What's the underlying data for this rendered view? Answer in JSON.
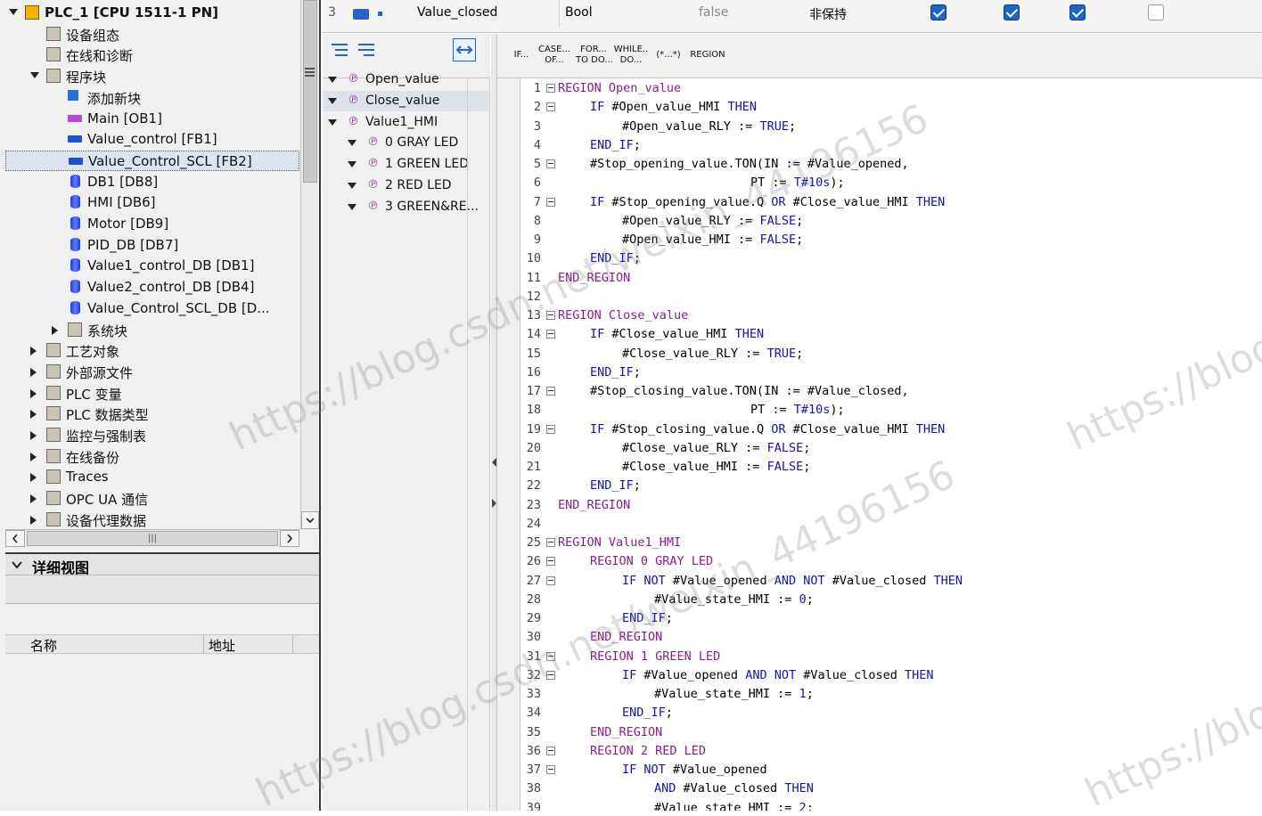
{
  "project_tree": {
    "items": [
      {
        "label": "PLC_1 [CPU 1511-1 PN]",
        "indent": 0,
        "toggle": "open",
        "icon": "plc-icon",
        "bold": true
      },
      {
        "label": "设备组态",
        "indent": 1,
        "toggle": "",
        "icon": "device-config-icon"
      },
      {
        "label": "在线和诊断",
        "indent": 1,
        "toggle": "",
        "icon": "online-diagnostics-icon"
      },
      {
        "label": "程序块",
        "indent": 1,
        "toggle": "open",
        "icon": "program-blocks-folder-icon"
      },
      {
        "label": "添加新块",
        "indent": 2,
        "toggle": "",
        "icon": "add-block-icon"
      },
      {
        "label": "Main [OB1]",
        "indent": 2,
        "toggle": "",
        "icon": "ob-block-icon"
      },
      {
        "label": "Value_control [FB1]",
        "indent": 2,
        "toggle": "",
        "icon": "fb-block-icon"
      },
      {
        "label": "Value_Control_SCL [FB2]",
        "indent": 2,
        "toggle": "",
        "icon": "fb-block-icon",
        "selected": true
      },
      {
        "label": "DB1 [DB8]",
        "indent": 2,
        "toggle": "",
        "icon": "db-block-icon"
      },
      {
        "label": "HMI [DB6]",
        "indent": 2,
        "toggle": "",
        "icon": "db-block-icon"
      },
      {
        "label": "Motor [DB9]",
        "indent": 2,
        "toggle": "",
        "icon": "db-block-icon"
      },
      {
        "label": "PID_DB [DB7]",
        "indent": 2,
        "toggle": "",
        "icon": "db-block-icon"
      },
      {
        "label": "Value1_control_DB [DB1]",
        "indent": 2,
        "toggle": "",
        "icon": "db-block-icon"
      },
      {
        "label": "Value2_control_DB [DB4]",
        "indent": 2,
        "toggle": "",
        "icon": "db-block-icon"
      },
      {
        "label": "Value_Control_SCL_DB [D...",
        "indent": 2,
        "toggle": "",
        "icon": "db-block-icon"
      },
      {
        "label": "系统块",
        "indent": 2,
        "toggle": "closed",
        "icon": "system-blocks-folder-icon"
      },
      {
        "label": "工艺对象",
        "indent": 1,
        "toggle": "closed",
        "icon": "technology-objects-icon"
      },
      {
        "label": "外部源文件",
        "indent": 1,
        "toggle": "closed",
        "icon": "external-sources-icon"
      },
      {
        "label": "PLC 变量",
        "indent": 1,
        "toggle": "closed",
        "icon": "plc-tags-icon"
      },
      {
        "label": "PLC 数据类型",
        "indent": 1,
        "toggle": "closed",
        "icon": "plc-datatypes-icon"
      },
      {
        "label": "监控与强制表",
        "indent": 1,
        "toggle": "closed",
        "icon": "watch-force-tables-icon"
      },
      {
        "label": "在线备份",
        "indent": 1,
        "toggle": "closed",
        "icon": "online-backups-icon"
      },
      {
        "label": "Traces",
        "indent": 1,
        "toggle": "closed",
        "icon": "traces-icon"
      },
      {
        "label": "OPC UA 通信",
        "indent": 1,
        "toggle": "closed",
        "icon": "opc-ua-icon"
      },
      {
        "label": "设备代理数据",
        "indent": 1,
        "toggle": "closed",
        "icon": "device-proxy-icon"
      }
    ]
  },
  "detail_view": {
    "title": "详细视图",
    "col_name": "名称",
    "col_address": "地址"
  },
  "interface_row": {
    "index": "3",
    "name": "Value_closed",
    "datatype": "Bool",
    "default": "false",
    "retain": "非保持",
    "checks": [
      true,
      true,
      true,
      false
    ]
  },
  "outline": {
    "items": [
      {
        "label": "Open_value",
        "indent": 0
      },
      {
        "label": "Close_value",
        "indent": 0,
        "selected": true
      },
      {
        "label": "Value1_HMI",
        "indent": 0
      },
      {
        "label": "0 GRAY LED",
        "indent": 1
      },
      {
        "label": "1 GREEN LED",
        "indent": 1
      },
      {
        "label": "2 RED LED",
        "indent": 1
      },
      {
        "label": "3 GREEN&RE...",
        "indent": 1
      }
    ]
  },
  "instructions": [
    {
      "label": "IF..."
    },
    {
      "label": "CASE...\nOF..."
    },
    {
      "label": "FOR...\nTO DO..."
    },
    {
      "label": "WHILE..\nDO..."
    },
    {
      "label": "(*...*)"
    },
    {
      "label": "REGION"
    }
  ],
  "code_lines": [
    {
      "n": "1",
      "fold": true,
      "indent": 0,
      "segs": [
        [
          "reg",
          "REGION Open_value"
        ]
      ]
    },
    {
      "n": "2",
      "fold": true,
      "indent": 1,
      "segs": [
        [
          "kw",
          "IF "
        ],
        [
          "",
          "#Open_value_HMI "
        ],
        [
          "kw",
          "THEN"
        ]
      ]
    },
    {
      "n": "3",
      "fold": false,
      "indent": 2,
      "segs": [
        [
          "",
          "#Open_value_RLY := "
        ],
        [
          "lit",
          "TRUE"
        ],
        [
          "",
          ";"
        ]
      ]
    },
    {
      "n": "4",
      "fold": false,
      "indent": 1,
      "segs": [
        [
          "kw",
          "END_IF"
        ],
        [
          "",
          ";"
        ]
      ]
    },
    {
      "n": "5",
      "fold": true,
      "indent": 1,
      "segs": [
        [
          "",
          "#Stop_opening_value.TON(IN := #Value_opened,"
        ]
      ]
    },
    {
      "n": "6",
      "fold": false,
      "indent": 6,
      "segs": [
        [
          "",
          "PT := "
        ],
        [
          "lit",
          "T#10s"
        ],
        [
          "",
          ");"
        ]
      ]
    },
    {
      "n": "7",
      "fold": true,
      "indent": 1,
      "segs": [
        [
          "kw",
          "IF "
        ],
        [
          "",
          "#Stop_opening_value.Q "
        ],
        [
          "kw",
          "OR "
        ],
        [
          "",
          "#Close_value_HMI "
        ],
        [
          "kw",
          "THEN"
        ]
      ]
    },
    {
      "n": "8",
      "fold": false,
      "indent": 2,
      "segs": [
        [
          "",
          "#Open_value_RLY := "
        ],
        [
          "lit",
          "FALSE"
        ],
        [
          "",
          ";"
        ]
      ]
    },
    {
      "n": "9",
      "fold": false,
      "indent": 2,
      "segs": [
        [
          "",
          "#Open_value_HMI := "
        ],
        [
          "lit",
          "FALSE"
        ],
        [
          "",
          ";"
        ]
      ]
    },
    {
      "n": "10",
      "fold": false,
      "indent": 1,
      "segs": [
        [
          "kw",
          "END_IF"
        ],
        [
          "",
          ";"
        ]
      ]
    },
    {
      "n": "11",
      "fold": false,
      "indent": 0,
      "segs": [
        [
          "reg",
          "END_REGION"
        ]
      ]
    },
    {
      "n": "12",
      "fold": false,
      "indent": 0,
      "segs": []
    },
    {
      "n": "13",
      "fold": true,
      "indent": 0,
      "segs": [
        [
          "reg",
          "REGION Close_value"
        ]
      ]
    },
    {
      "n": "14",
      "fold": true,
      "indent": 1,
      "segs": [
        [
          "kw",
          "IF "
        ],
        [
          "",
          "#Close_value_HMI "
        ],
        [
          "kw",
          "THEN"
        ]
      ]
    },
    {
      "n": "15",
      "fold": false,
      "indent": 2,
      "segs": [
        [
          "",
          "#Close_value_RLY := "
        ],
        [
          "lit",
          "TRUE"
        ],
        [
          "",
          ";"
        ]
      ]
    },
    {
      "n": "16",
      "fold": false,
      "indent": 1,
      "segs": [
        [
          "kw",
          "END_IF"
        ],
        [
          "",
          ";"
        ]
      ]
    },
    {
      "n": "17",
      "fold": true,
      "indent": 1,
      "segs": [
        [
          "",
          "#Stop_closing_value.TON(IN := #Value_closed,"
        ]
      ]
    },
    {
      "n": "18",
      "fold": false,
      "indent": 6,
      "segs": [
        [
          "",
          "PT := "
        ],
        [
          "lit",
          "T#10s"
        ],
        [
          "",
          ");"
        ]
      ]
    },
    {
      "n": "19",
      "fold": true,
      "indent": 1,
      "segs": [
        [
          "kw",
          "IF "
        ],
        [
          "",
          "#Stop_closing_value.Q "
        ],
        [
          "kw",
          "OR "
        ],
        [
          "",
          "#Close_value_HMI "
        ],
        [
          "kw",
          "THEN"
        ]
      ]
    },
    {
      "n": "20",
      "fold": false,
      "indent": 2,
      "segs": [
        [
          "",
          "#Close_value_RLY := "
        ],
        [
          "lit",
          "FALSE"
        ],
        [
          "",
          ";"
        ]
      ]
    },
    {
      "n": "21",
      "fold": false,
      "indent": 2,
      "segs": [
        [
          "",
          "#Close_value_HMI := "
        ],
        [
          "lit",
          "FALSE"
        ],
        [
          "",
          ";"
        ]
      ]
    },
    {
      "n": "22",
      "fold": false,
      "indent": 1,
      "segs": [
        [
          "kw",
          "END_IF"
        ],
        [
          "",
          ";"
        ]
      ]
    },
    {
      "n": "23",
      "fold": false,
      "indent": 0,
      "segs": [
        [
          "reg",
          "END_REGION"
        ]
      ]
    },
    {
      "n": "24",
      "fold": false,
      "indent": 0,
      "segs": []
    },
    {
      "n": "25",
      "fold": true,
      "indent": 0,
      "segs": [
        [
          "reg",
          "REGION Value1_HMI"
        ]
      ]
    },
    {
      "n": "26",
      "fold": true,
      "indent": 1,
      "segs": [
        [
          "reg",
          "REGION 0 GRAY LED"
        ]
      ]
    },
    {
      "n": "27",
      "fold": true,
      "indent": 2,
      "segs": [
        [
          "kw",
          "IF NOT "
        ],
        [
          "",
          "#Value_opened "
        ],
        [
          "kw",
          "AND NOT "
        ],
        [
          "",
          "#Value_closed "
        ],
        [
          "kw",
          "THEN"
        ]
      ]
    },
    {
      "n": "28",
      "fold": false,
      "indent": 3,
      "segs": [
        [
          "",
          "#Value_state_HMI := "
        ],
        [
          "lit",
          "0"
        ],
        [
          "",
          ";"
        ]
      ]
    },
    {
      "n": "29",
      "fold": false,
      "indent": 2,
      "segs": [
        [
          "kw",
          "END_IF"
        ],
        [
          "",
          ";"
        ]
      ]
    },
    {
      "n": "30",
      "fold": false,
      "indent": 1,
      "segs": [
        [
          "reg",
          "END_REGION"
        ]
      ]
    },
    {
      "n": "31",
      "fold": true,
      "indent": 1,
      "segs": [
        [
          "reg",
          "REGION 1 GREEN LED"
        ]
      ]
    },
    {
      "n": "32",
      "fold": true,
      "indent": 2,
      "segs": [
        [
          "kw",
          "IF "
        ],
        [
          "",
          "#Value_opened "
        ],
        [
          "kw",
          "AND NOT "
        ],
        [
          "",
          "#Value_closed "
        ],
        [
          "kw",
          "THEN"
        ]
      ]
    },
    {
      "n": "33",
      "fold": false,
      "indent": 3,
      "segs": [
        [
          "",
          "#Value_state_HMI := "
        ],
        [
          "lit",
          "1"
        ],
        [
          "",
          ";"
        ]
      ]
    },
    {
      "n": "34",
      "fold": false,
      "indent": 2,
      "segs": [
        [
          "kw",
          "END_IF"
        ],
        [
          "",
          ";"
        ]
      ]
    },
    {
      "n": "35",
      "fold": false,
      "indent": 1,
      "segs": [
        [
          "reg",
          "END_REGION"
        ]
      ]
    },
    {
      "n": "36",
      "fold": true,
      "indent": 1,
      "segs": [
        [
          "reg",
          "REGION 2 RED LED"
        ]
      ]
    },
    {
      "n": "37",
      "fold": true,
      "indent": 2,
      "segs": [
        [
          "kw",
          "IF NOT "
        ],
        [
          "",
          "#Value_opened"
        ]
      ]
    },
    {
      "n": "38",
      "fold": false,
      "indent": 3,
      "segs": [
        [
          "kw",
          "AND "
        ],
        [
          "",
          "#Value_closed "
        ],
        [
          "kw",
          "THEN"
        ]
      ]
    },
    {
      "n": "39",
      "fold": false,
      "indent": 3,
      "segs": [
        [
          "",
          "#Value_state_HMI := "
        ],
        [
          "lit",
          "2"
        ],
        [
          "",
          ";"
        ]
      ]
    }
  ],
  "watermarks": [
    "https://blog.csdn.net/weixin_44196156",
    "https://blog",
    "https://blog",
    "56",
    "56"
  ]
}
